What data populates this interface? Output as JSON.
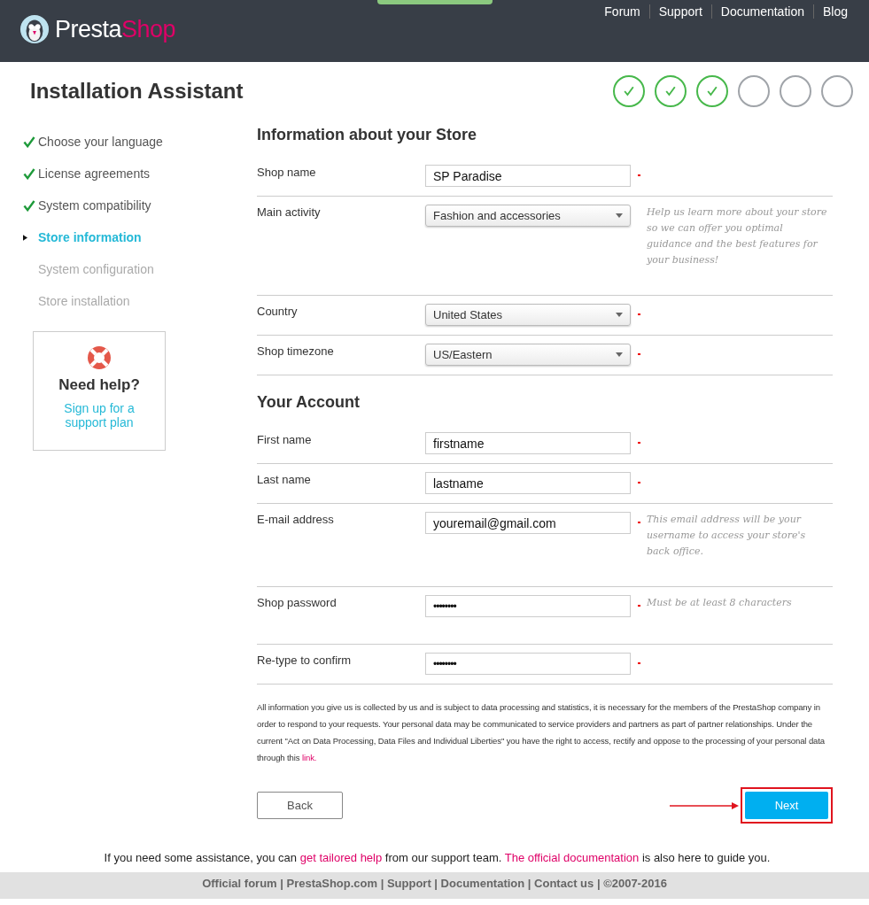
{
  "header": {
    "logo": {
      "first": "Presta",
      "second": "Shop"
    },
    "nav": [
      "Forum",
      "Support",
      "Documentation",
      "Blog"
    ]
  },
  "title": "Installation Assistant",
  "progress": [
    {
      "done": true
    },
    {
      "done": true
    },
    {
      "done": true
    },
    {
      "done": false
    },
    {
      "done": false
    },
    {
      "done": false
    }
  ],
  "steps": [
    {
      "label": "Choose your language",
      "kind": "done"
    },
    {
      "label": "License agreements",
      "kind": "done"
    },
    {
      "label": "System compatibility",
      "kind": "done"
    },
    {
      "label": "Store information",
      "kind": "current"
    },
    {
      "label": "System configuration",
      "kind": "todo"
    },
    {
      "label": "Store installation",
      "kind": "todo"
    }
  ],
  "help": {
    "title": "Need help?",
    "link": "Sign up for a support plan"
  },
  "sections": [
    {
      "title": "Information about your Store",
      "rows": [
        {
          "label": "Shop name",
          "kind": "text",
          "value": "SP Paradise",
          "required": true
        },
        {
          "label": "Main activity",
          "kind": "select",
          "value": "Fashion and accessories",
          "required": false,
          "hint": "Help us learn more about your store so we can offer you optimal guidance and the best features for your business!"
        },
        {
          "label": "Country",
          "kind": "select",
          "value": "United States",
          "required": true
        },
        {
          "label": "Shop timezone",
          "kind": "select",
          "value": "US/Eastern",
          "required": true
        }
      ]
    },
    {
      "title": "Your Account",
      "rows": [
        {
          "label": "First name",
          "kind": "text",
          "value": "firstname",
          "required": true
        },
        {
          "label": "Last name",
          "kind": "text",
          "value": "lastname",
          "required": true
        },
        {
          "label": "E-mail address",
          "kind": "text",
          "value": "youremail@gmail.com",
          "required": true,
          "hint": "This email address will be your username to access your store's back office."
        },
        {
          "label": "Shop password",
          "kind": "password",
          "value": "••••••••",
          "required": true,
          "hint": "Must be at least 8 characters"
        },
        {
          "label": "Re-type to confirm",
          "kind": "password",
          "value": "••••••••",
          "required": true
        }
      ]
    }
  ],
  "privacy": {
    "text": "All information you give us is collected by us and is subject to data processing and statistics, it is necessary for the members of the PrestaShop company in order to respond to your requests. Your personal data may be communicated to service providers and partners as part of partner relationships. Under the current \"Act on Data Processing, Data Files and Individual Liberties\" you have the right to access, rectify and oppose to the processing of your personal data through this",
    "link": "link."
  },
  "buttons": {
    "back": "Back",
    "next": {
      "label": "Next",
      "highlighted": true
    }
  },
  "assist": [
    {
      "kind": "text",
      "text": "If you need some assistance, you can"
    },
    {
      "kind": "link",
      "text": "get tailored help"
    },
    {
      "kind": "text",
      "text": "from our support team."
    },
    {
      "kind": "link",
      "text": "The official documentation"
    },
    {
      "kind": "text",
      "text": "is also here to guide you."
    }
  ],
  "footer": "Official forum | PrestaShop.com | Support | Documentation | Contact us | ©2007-2016"
}
